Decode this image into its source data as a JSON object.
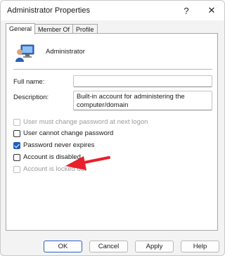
{
  "window": {
    "title": "Administrator Properties",
    "help_glyph": "?",
    "close_glyph": "✕"
  },
  "tabs": [
    {
      "label": "General",
      "active": true
    },
    {
      "label": "Member Of",
      "active": false
    },
    {
      "label": "Profile",
      "active": false
    }
  ],
  "user": {
    "name": "Administrator",
    "icon": "computer-user-icon"
  },
  "fields": {
    "full_name": {
      "label": "Full name:",
      "value": ""
    },
    "description": {
      "label": "Description:",
      "value_line1": "Built-in account for administering the",
      "value_line2": "computer/domain"
    }
  },
  "checkboxes": [
    {
      "label": "User must change password at next logon",
      "checked": false,
      "disabled": true
    },
    {
      "label": "User cannot change password",
      "checked": false,
      "disabled": false
    },
    {
      "label": "Password never expires",
      "checked": true,
      "disabled": false
    },
    {
      "label": "Account is disabled",
      "checked": false,
      "disabled": false
    },
    {
      "label": "Account is locked out",
      "checked": false,
      "disabled": true
    }
  ],
  "annotation": {
    "color": "#e8202a",
    "icon": "red-arrow-icon"
  },
  "buttons": {
    "ok": "OK",
    "cancel": "Cancel",
    "apply": "Apply",
    "help": "Help"
  }
}
